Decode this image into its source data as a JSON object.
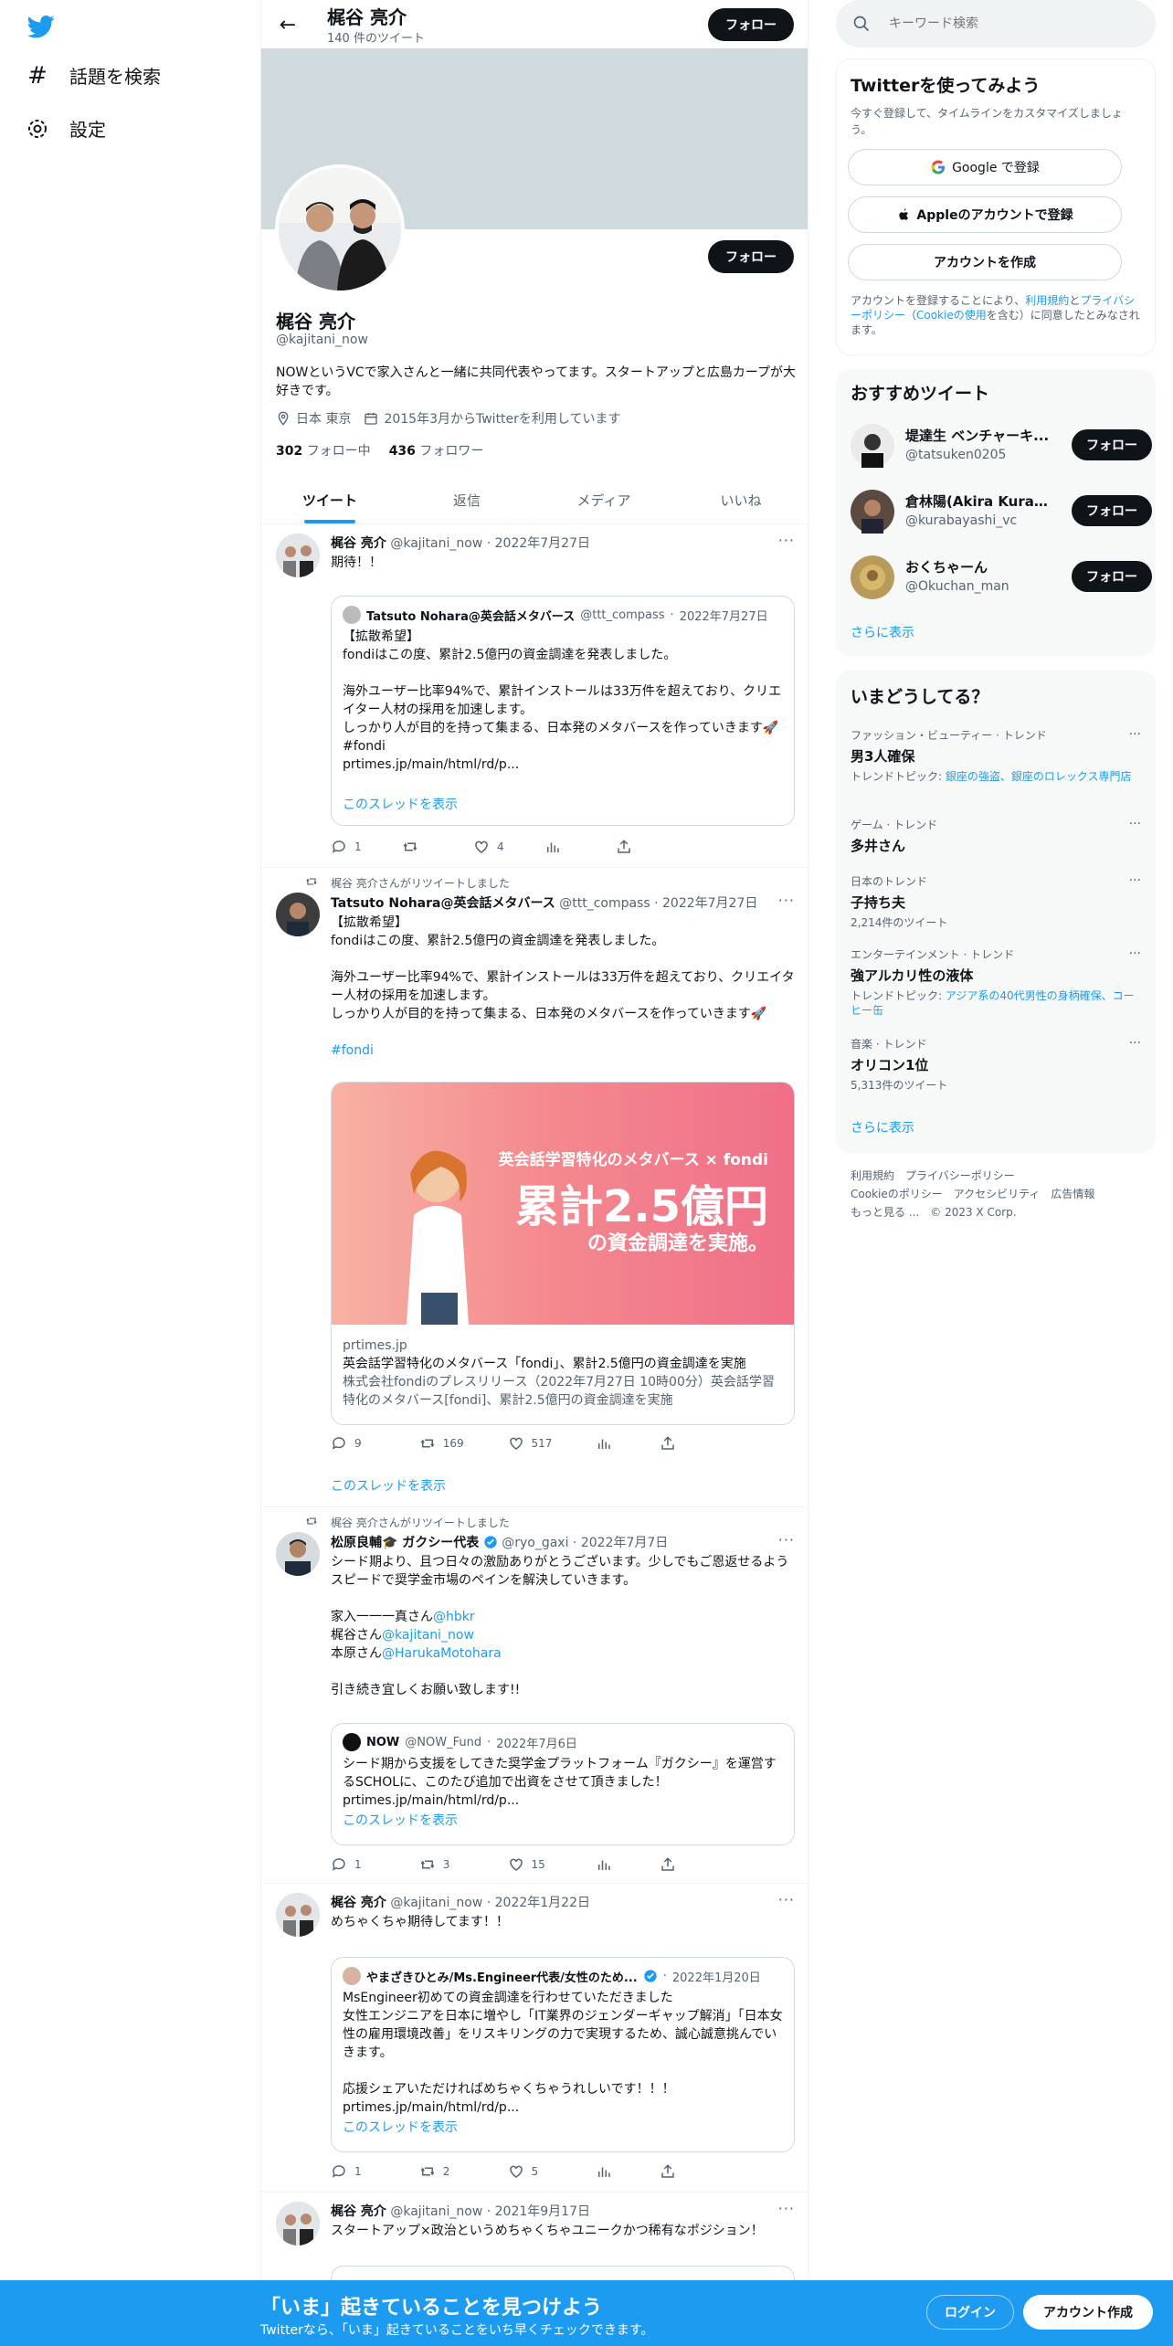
{
  "nav": {
    "explore": "話題を検索",
    "settings": "設定"
  },
  "header": {
    "name": "梶谷 亮介",
    "tweet_count": "140 件のツイート",
    "follow": "フォロー"
  },
  "profile": {
    "name": "梶谷 亮介",
    "handle": "@kajitani_now",
    "bio": "NOWというVCで家入さんと一緒に共同代表やってます。スタートアップと広島カープが大好きです。",
    "location": "日本 東京",
    "joined": "2015年3月からTwitterを利用しています",
    "following_count": "302",
    "following_label": "フォロー中",
    "followers_count": "436",
    "followers_label": "フォロワー",
    "follow": "フォロー"
  },
  "tabs": [
    "ツイート",
    "返信",
    "メディア",
    "いいね"
  ],
  "tweets": [
    {
      "name": "梶谷 亮介",
      "handle": "@kajitani_now",
      "date": "2022年7月27日",
      "text": "期待！！",
      "quote": {
        "name": "Tatsuto Nohara@英会話メタバース",
        "handle": "@ttt_compass",
        "date": "2022年7月27日",
        "text": "【拡散希望】\nfondiはこの度、累計2.5億円の資金調達を発表しました。\n\n海外ユーザー比率94%で、累計インストールは33万件を超えており、クリエイター人材の採用を加速します。\nしっかり人が目的を持って集まる、日本発のメタバースを作っていきます🚀\n#fondi\nprtimes.jp/main/html/rd/p...",
        "show_thread": "このスレッドを表示"
      },
      "replies": "1",
      "retweets": "",
      "likes": "4"
    },
    {
      "rt_label": "梶谷 亮介さんがリツイートしました",
      "name": "Tatsuto Nohara@英会話メタバース",
      "handle": "@ttt_compass",
      "date": "2022年7月27日",
      "text": "【拡散希望】\nfondiはこの度、累計2.5億円の資金調達を発表しました。\n\n海外ユーザー比率94%で、累計インストールは33万件を超えており、クリエイター人材の採用を加速します。\nしっかり人が目的を持って集まる、日本発のメタバースを作っていきます🚀",
      "hashtag": "#fondi",
      "card": {
        "img_line1": "英会話学習特化のメタバース × fondi",
        "img_line2": "累計2.5億円",
        "img_line3": "の資金調達を実施。",
        "domain": "prtimes.jp",
        "title": "英会話学習特化のメタバース「fondi」、累計2.5億円の資金調達を実施",
        "desc": "株式会社fondiのプレスリリース（2022年7月27日 10時00分）英会話学習特化のメタバース[fondi]、累計2.5億円の資金調達を実施"
      },
      "replies": "9",
      "retweets": "169",
      "likes": "517",
      "show_thread": "このスレッドを表示"
    },
    {
      "rt_label": "梶谷 亮介さんがリツイートしました",
      "name": "松原良輔🎓 ガクシー代表",
      "handle": "@ryo_gaxi",
      "date": "2022年7月7日",
      "text": "シード期より、且つ日々の激励ありがとうございます。少しでもご恩返せるようスピードで奨学金市場のペインを解決していきます。",
      "mention_lines": [
        {
          "prefix": "家入一一一真さん",
          "mention": "@hbkr"
        },
        {
          "prefix": "梶谷さん",
          "mention": "@kajitani_now"
        },
        {
          "prefix": "本原さん",
          "mention": "@HarukaMotohara"
        }
      ],
      "closing": "引き続き宜しくお願い致します!!",
      "quote": {
        "name": "NOW",
        "handle": "@NOW_Fund",
        "date": "2022年7月6日",
        "text": "シード期から支援をしてきた奨学金プラットフォーム『ガクシー』を運営するSCHOLに、このたび追加で出資をさせて頂きました！prtimes.jp/main/html/rd/p...",
        "show_thread": "このスレッドを表示"
      },
      "replies": "1",
      "retweets": "3",
      "likes": "15"
    },
    {
      "name": "梶谷 亮介",
      "handle": "@kajitani_now",
      "date": "2022年1月22日",
      "text": "めちゃくちゃ期待してます！！",
      "quote": {
        "name": "やまざきひとみ/Ms.Engineer代表/女性のため...",
        "handle": "",
        "date": "2022年1月20日",
        "text": "MsEngineer初めての資金調達を行わせていただきました\n女性エンジニアを日本に増やし「IT業界のジェンダーギャップ解消」「日本女性の雇用環境改善」をリスキリングの力で実現するため、誠心誠意挑んでいきます。\n\n応援シェアいただければめちゃくちゃうれしいです！！！\nprtimes.jp/main/html/rd/p...",
        "show_thread": "このスレッドを表示"
      },
      "replies": "1",
      "retweets": "2",
      "likes": "5"
    },
    {
      "name": "梶谷 亮介",
      "handle": "@kajitani_now",
      "date": "2021年9月17日",
      "text": "スタートアップ×政治というめちゃくちゃユニークかつ稀有なポジション！"
    }
  ],
  "search": {
    "placeholder": "キーワード検索"
  },
  "signup": {
    "title": "Twitterを使ってみよう",
    "subtitle": "今すぐ登録して、タイムラインをカスタマイズしましょう。",
    "google": "Google で登録",
    "apple": "Appleのアカウントで登録",
    "create": "アカウントを作成",
    "legal_pre": "アカウントを登録することにより、",
    "legal_terms": "利用規約",
    "legal_and": "と",
    "legal_privacy": "プライバシーポリシー",
    "legal_mid": "（",
    "legal_cookie": "Cookieの使用",
    "legal_post": "を含む）に同意したとみなされます。"
  },
  "recommended": {
    "title": "おすすめツイート",
    "users": [
      {
        "name": "堤達生 ベンチャーキ...",
        "handle": "@tatsuken0205",
        "follow": "フォロー"
      },
      {
        "name": "倉林陽(Akira Kuraba...",
        "handle": "@kurabayashi_vc",
        "follow": "フォロー"
      },
      {
        "name": "おくちゃーん",
        "handle": "@Okuchan_man",
        "follow": "フォロー"
      }
    ],
    "show_more": "さらに表示"
  },
  "trends": {
    "title": "いまどうしてる？",
    "items": [
      {
        "cat": "ファッション・ビューティー · トレンド",
        "name": "男3人確保",
        "extra_pre": "トレンドトピック: ",
        "extra_link": "銀座の強盗、銀座のロレックス専門店"
      },
      {
        "cat": "ゲーム · トレンド",
        "name": "多井さん"
      },
      {
        "cat": "日本のトレンド",
        "name": "子持ち夫",
        "extra": "2,214件のツイート"
      },
      {
        "cat": "エンターテインメント · トレンド",
        "name": "強アルカリ性の液体",
        "extra_pre": "トレンドトピック: ",
        "extra_link": "アジア系の40代男性の身柄確保、コーヒー缶"
      },
      {
        "cat": "音楽 · トレンド",
        "name": "オリコン1位",
        "extra": "5,313件のツイート"
      }
    ],
    "show_more": "さらに表示"
  },
  "footer": {
    "links": [
      "利用規約",
      "プライバシーポリシー",
      "Cookieのポリシー",
      "アクセシビリティ",
      "広告情報",
      "もっと見る ...",
      "© 2023 X Corp."
    ]
  },
  "bottombar": {
    "title": "「いま」起きていることを見つけよう",
    "subtitle": "Twitterなら、「いま」起きていることをいち早くチェックできます。",
    "login": "ログイン",
    "signup": "アカウント作成"
  },
  "colors": {
    "accent": "#1d9bf0",
    "text": "#0f1419",
    "muted": "#536471",
    "banner": "#cfd9de"
  }
}
